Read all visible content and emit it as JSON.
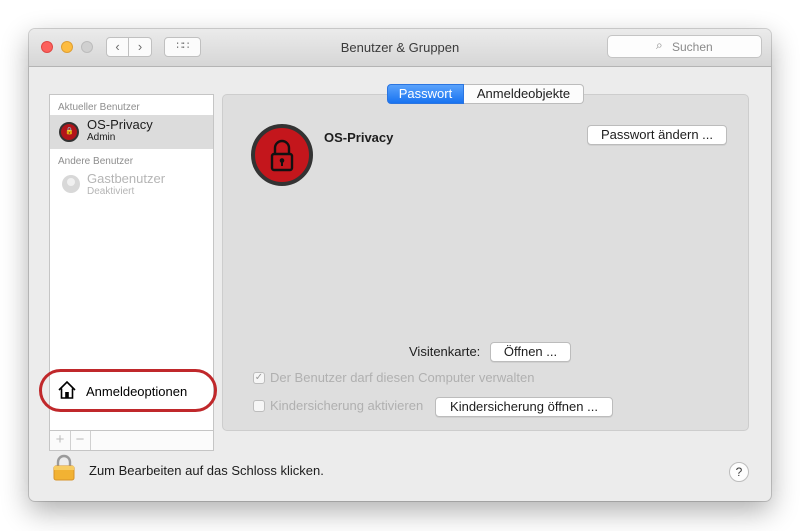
{
  "window": {
    "title": "Benutzer & Gruppen",
    "nav_back": "‹",
    "nav_forward": "›",
    "grid_icon": "∷∷",
    "search_placeholder": "Suchen"
  },
  "sidebar": {
    "current_header": "Aktueller Benutzer",
    "current_user": {
      "name": "OS-Privacy",
      "role": "Admin"
    },
    "other_header": "Andere Benutzer",
    "other_users": [
      {
        "name": "Gastbenutzer",
        "status": "Deaktiviert"
      }
    ],
    "login_options_label": "Anmeldeoptionen",
    "add_button": "+",
    "remove_button": "−"
  },
  "tabs": [
    {
      "label": "Passwort",
      "active": true
    },
    {
      "label": "Anmeldeobjekte",
      "active": false
    }
  ],
  "main": {
    "user_name": "OS-Privacy",
    "change_password_button": "Passwort ändern ...",
    "vcard_label": "Visitenkarte:",
    "vcard_open_button": "Öffnen ...",
    "allow_admin_label": "Der Benutzer darf diesen Computer verwalten",
    "allow_admin_checked": true,
    "parental_control_label": "Kindersicherung aktivieren",
    "parental_control_checked": false,
    "open_parental_control_button": "Kindersicherung öffnen ..."
  },
  "footer": {
    "lock_text": "Zum Bearbeiten auf das Schloss klicken.",
    "help_label": "?"
  },
  "colors": {
    "accent": "#1873f1",
    "avatar_red": "#c4161c",
    "highlight_red": "#c0282b"
  },
  "icons": [
    "close-icon",
    "minimize-icon",
    "zoom-icon",
    "search-icon",
    "padlock-icon",
    "house-icon",
    "guest-user-icon",
    "lock-icon",
    "help-icon"
  ]
}
